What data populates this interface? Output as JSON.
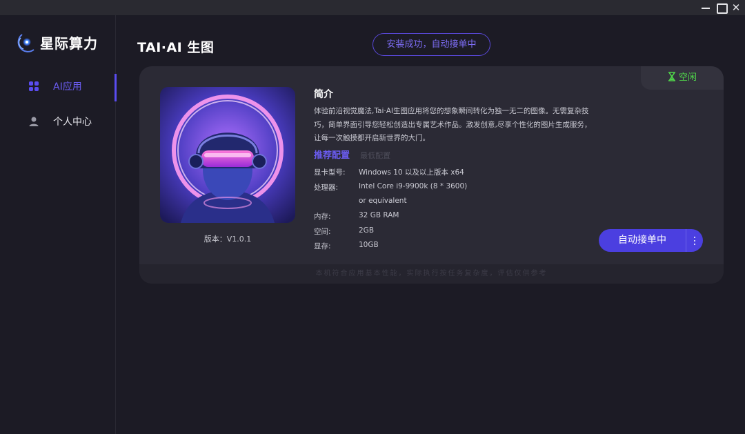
{
  "window": {
    "controls": [
      "minimize-icon",
      "maximize-icon",
      "close-icon"
    ]
  },
  "app": {
    "logo_text": "星际算力"
  },
  "sidebar": {
    "items": [
      {
        "label": "AI应用",
        "icon": "apps-grid-icon",
        "active": true
      },
      {
        "label": "个人中心",
        "icon": "user-icon",
        "active": false
      }
    ]
  },
  "header": {
    "title": "TAI·AI 生图",
    "status_pill": "安装成功，自动接单中"
  },
  "card": {
    "status_badge": "空闲",
    "version": "版本：V1.0.1",
    "intro_title": "简介",
    "intro_text": "体验前沿视觉魔法,Tai·AI生图应用将您的想象瞬间转化为独一无二的图像。无需复杂技巧，简单界面引导您轻松创造出专属艺术作品。激发创意,尽享个性化的图片生成服务，让每一次触摸都开启新世界的大门。",
    "tab_recommended": "推荐配置",
    "tab_minimum": "最低配置",
    "specs": [
      {
        "key": "显卡型号:",
        "value": "Windows 10 以及以上版本 x64"
      },
      {
        "key": "处理器:",
        "value": "Intel Core i9-9900k (8 * 3600)"
      },
      {
        "key": "",
        "value": "or equivalent"
      },
      {
        "key": "内存:",
        "value": "32 GB RAM"
      },
      {
        "key": "空间:",
        "value": "2GB"
      },
      {
        "key": "显存:",
        "value": "10GB"
      }
    ],
    "action_button": "自动接单中",
    "footer_note": "本机符合应用基本性能，实际执行按任务复杂度，评估仅供参考",
    "colors": {
      "accent": "#5a4cf0",
      "idle_green": "#4fd34a"
    }
  }
}
